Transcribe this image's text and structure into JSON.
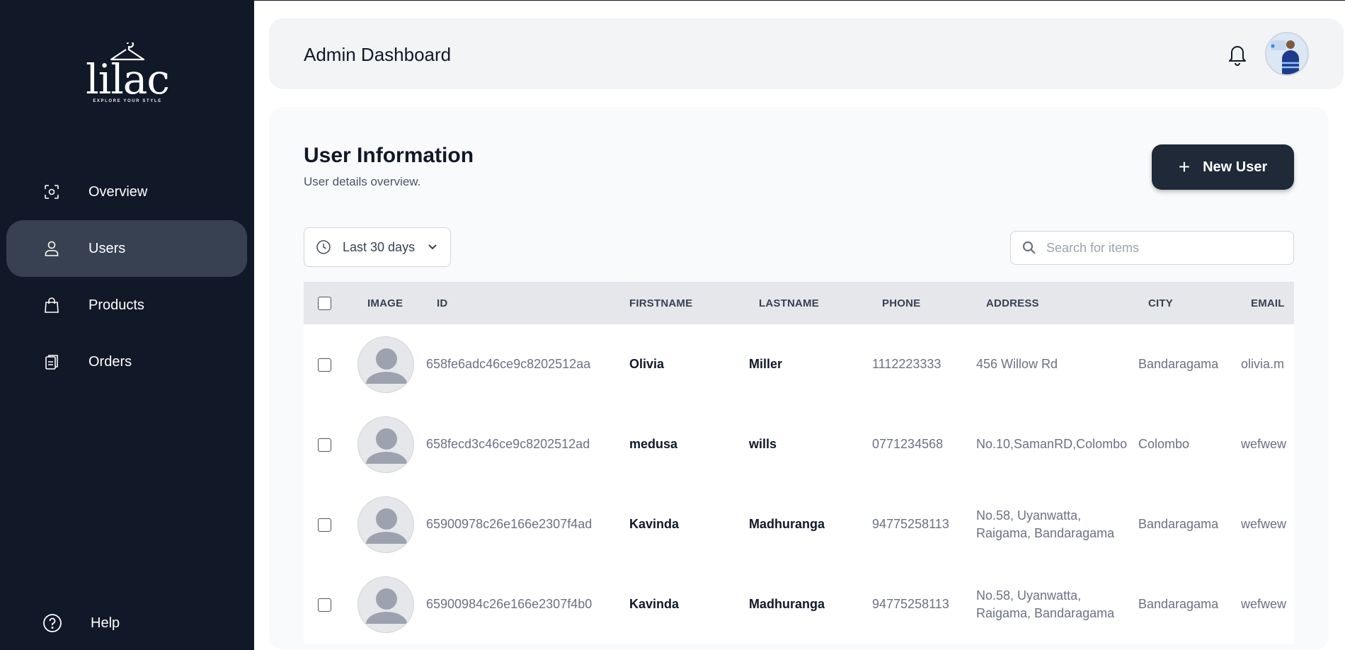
{
  "brand": {
    "name": "lilac",
    "tagline": "EXPLORE YOUR STYLE"
  },
  "sidebar": {
    "items": [
      {
        "label": "Overview",
        "icon": "overview-icon",
        "active": false
      },
      {
        "label": "Users",
        "icon": "user-icon",
        "active": true
      },
      {
        "label": "Products",
        "icon": "shopping-bag-icon",
        "active": false
      },
      {
        "label": "Orders",
        "icon": "clipboard-icon",
        "active": false
      }
    ],
    "help_label": "Help"
  },
  "header": {
    "title": "Admin Dashboard"
  },
  "section": {
    "title": "User Information",
    "subtitle": "User details overview.",
    "new_button": "New User"
  },
  "filters": {
    "range_label": "Last 30 days",
    "search_placeholder": "Search for items"
  },
  "table": {
    "columns": [
      "IMAGE",
      "ID",
      "FIRSTNAME",
      "LASTNAME",
      "PHONE",
      "ADDRESS",
      "CITY",
      "EMAIL"
    ],
    "rows": [
      {
        "id": "658fe6adc46ce9c8202512aa",
        "firstname": "Olivia",
        "lastname": "Miller",
        "phone": "1112223333",
        "address_line1": "456 Willow Rd",
        "address_line2": "",
        "city": "Bandaragama",
        "email": "olivia.m"
      },
      {
        "id": "658fecd3c46ce9c8202512ad",
        "firstname": "medusa",
        "lastname": "wills",
        "phone": "0771234568",
        "address_line1": "No.10,SamanRD,Colombo",
        "address_line2": "",
        "city": "Colombo",
        "email": "wefwew"
      },
      {
        "id": "65900978c26e166e2307f4ad",
        "firstname": "Kavinda",
        "lastname": "Madhuranga",
        "phone": "94775258113",
        "address_line1": "No.58, Uyanwatta,",
        "address_line2": "Raigama, Bandaragama",
        "city": "Bandaragama",
        "email": "wefwew"
      },
      {
        "id": "65900984c26e166e2307f4b0",
        "firstname": "Kavinda",
        "lastname": "Madhuranga",
        "phone": "94775258113",
        "address_line1": "No.58, Uyanwatta,",
        "address_line2": "Raigama, Bandaragama",
        "city": "Bandaragama",
        "email": "wefwew"
      }
    ]
  },
  "colors": {
    "sidebar_bg": "#111827",
    "active_item_bg": "#374151",
    "primary_button": "#1f2937",
    "table_header_bg": "#e5e7eb"
  }
}
